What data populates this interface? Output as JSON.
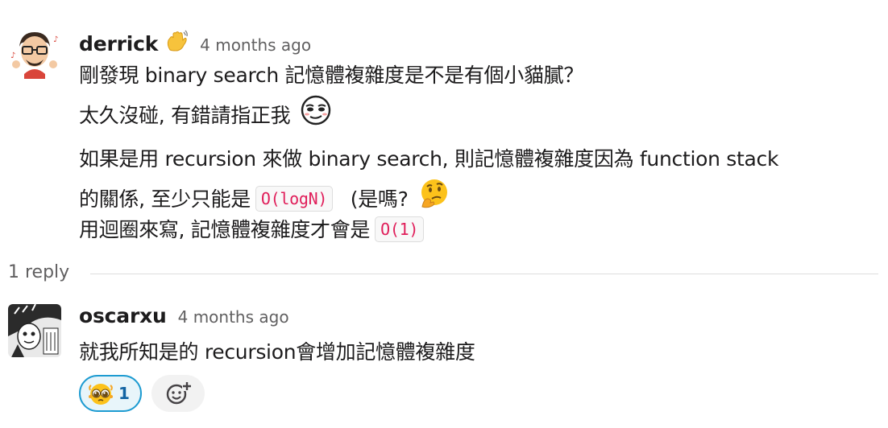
{
  "thread": {
    "parent": {
      "author": "derrick",
      "status_emoji": "hand-wave-emoji",
      "timestamp": "4 months ago",
      "lines": [
        "剛發現 binary search 記憶體複雜度是不是有個小貓膩？",
        "太久沒碰, 有錯請指正我"
      ],
      "para2_line1": "如果是用 recursion 來做 binary search, 則記憶體複雜度因為 function stack",
      "para2_line2_prefix": "的關係, 至少只能是",
      "para2_line2_code": "O(logN)",
      "para2_line2_suffix": "(是嗎?",
      "para2_line3_prefix": "用迴圈來寫, 記憶體複雜度才會是",
      "para2_line3_code": "O(1)"
    },
    "reply_count_label": "1 reply",
    "reply": {
      "author": "oscarxu",
      "timestamp": "4 months ago",
      "text": "就我所知是的 recursion會增加記憶體複雜度",
      "reaction": {
        "emoji": "pleading-face-emoji",
        "count": "1"
      }
    }
  },
  "colors": {
    "link_blue": "#1264a3",
    "reaction_border": "#1d9bd1",
    "code_red": "#e01e5a",
    "muted_text": "#616061"
  }
}
